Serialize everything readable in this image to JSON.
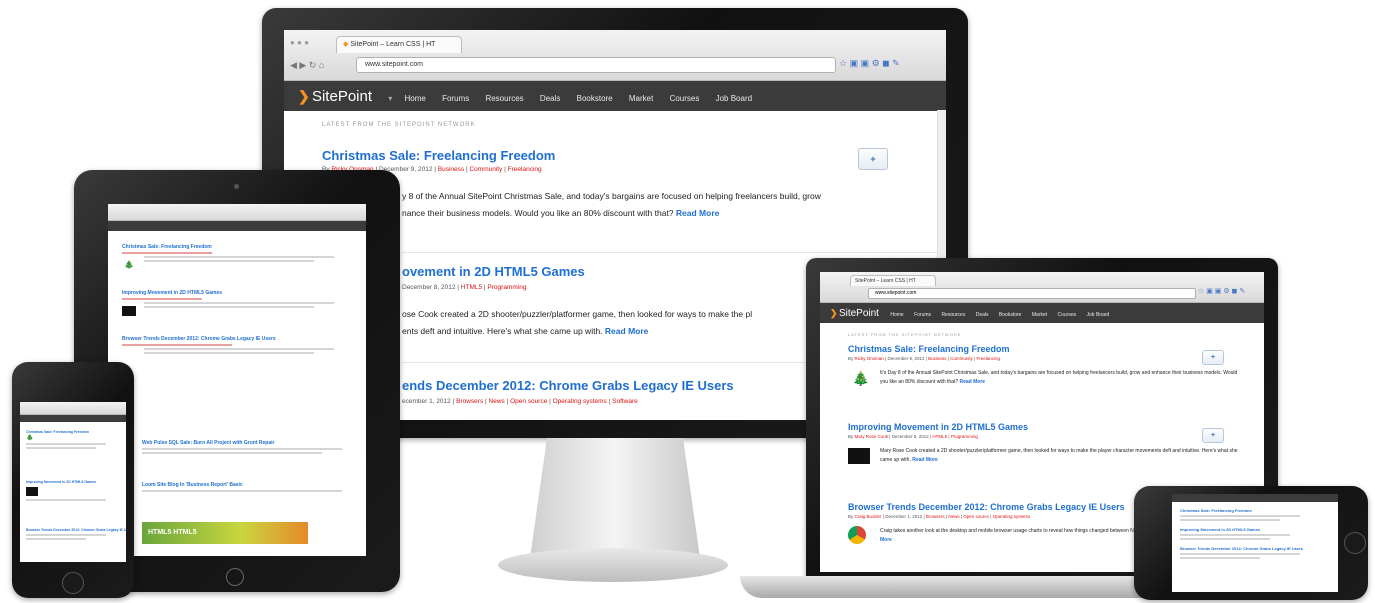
{
  "browser": {
    "tab_title": "SitePoint – Learn CSS | HT",
    "url": "www.sitepoint.com"
  },
  "site": {
    "logo_text": "SitePoint",
    "nav": [
      "Home",
      "Forums",
      "Resources",
      "Deals",
      "Bookstore",
      "Market",
      "Courses",
      "Job Board"
    ],
    "section_heading": "LATEST FROM THE SITEPOINT NETWORK"
  },
  "articles": [
    {
      "title": "Christmas Sale: Freelancing Freedom",
      "author": "Ricky Onsman",
      "date": "December 9, 2012",
      "categories": [
        "Business",
        "Community",
        "Freelancing"
      ],
      "excerpt": "It's Day 8 of the Annual SitePoint Christmas Sale, and today's bargains are focused on helping freelancers build, grow and enhance their business models. Would you like an 80% discount with that?",
      "read_more": "Read More"
    },
    {
      "title": "Improving Movement in 2D HTML5 Games",
      "author": "Mary Rose Cook",
      "date": "December 8, 2012",
      "categories": [
        "HTML5",
        "Programming"
      ],
      "excerpt": "Mary Rose Cook created a 2D shooter/puzzler/platformer game, then looked for ways to make the player character movements deft and intuitive. Here's what she came up with.",
      "read_more": "Read More"
    },
    {
      "title": "Browser Trends December 2012: Chrome Grabs Legacy IE Users",
      "author": "Craig Buckler",
      "date": "December 1, 2012",
      "categories": [
        "Browsers",
        "News",
        "Open source",
        "Operating systems",
        "Software"
      ],
      "excerpt": "Craig takes another look at the desktop and mobile browser usage charts to reveal how things changed between November and the past twelve months.",
      "read_more": "Read More"
    }
  ],
  "desktop_partial": {
    "title2": "ovement in 2D HTML5 Games",
    "excerpt1": "y 8 of the Annual SitePoint Christmas Sale, and today's bargains are focused on helping freelancers build, grow",
    "excerpt1b": "nance their business models. Would you like an 80% discount with that?",
    "excerpt2": "ose Cook created a 2D shooter/puzzler/platformer game, then looked for ways to make the pl",
    "excerpt2b": "ents deft and intuitive. Here's what she came up with.",
    "title3": "ends December 2012: Chrome Grabs Legacy IE Users",
    "meta2_date": "December 8, 2012",
    "meta3_date": "ecember 1, 2012"
  },
  "tablet_partial": {
    "item1": "Web Pulse SQL Sale: Burn All Project with Grunt Repair",
    "item2": "Loom Site Blog In 'Business Report' Basic"
  },
  "phone_banner": "HTML5 HTML5",
  "colors": {
    "accent": "#1f6fd1",
    "category": "#dd1111",
    "navbar": "#3b3b3b",
    "logo": "#f6921e"
  }
}
